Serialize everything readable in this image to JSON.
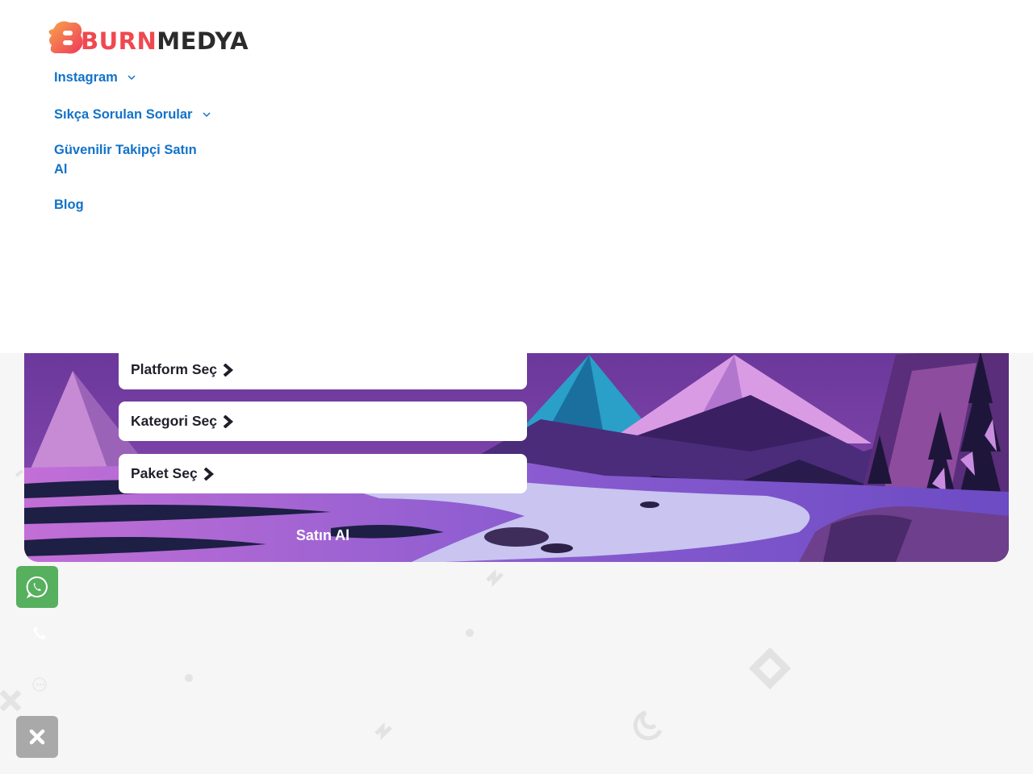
{
  "logo": {
    "text_burn": "BURN",
    "text_medya": "MEDYA",
    "accent": "#f0484f",
    "dark": "#2b2b2b"
  },
  "nav": {
    "items": [
      {
        "label": "Instagram",
        "has_dropdown": true
      },
      {
        "label": "Sıkça Sorulan Sorular",
        "has_dropdown": true
      },
      {
        "label": "Güvenilir Takipçi Satın Al",
        "has_dropdown": false
      },
      {
        "label": "Blog",
        "has_dropdown": false
      }
    ],
    "color": "#1272c9"
  },
  "order_form": {
    "platform_label": "Platform Seç",
    "category_label": "Kategori Seç",
    "package_label": "Paket Seç",
    "buy_label": "Satın Al"
  },
  "floating": {
    "whatsapp_icon": "whatsapp-icon",
    "phone_icon": "phone-icon",
    "chat_icon": "chat-icon",
    "close_icon": "close-icon",
    "whatsapp_color": "#56b05e",
    "close_color": "#a9a9a9"
  }
}
